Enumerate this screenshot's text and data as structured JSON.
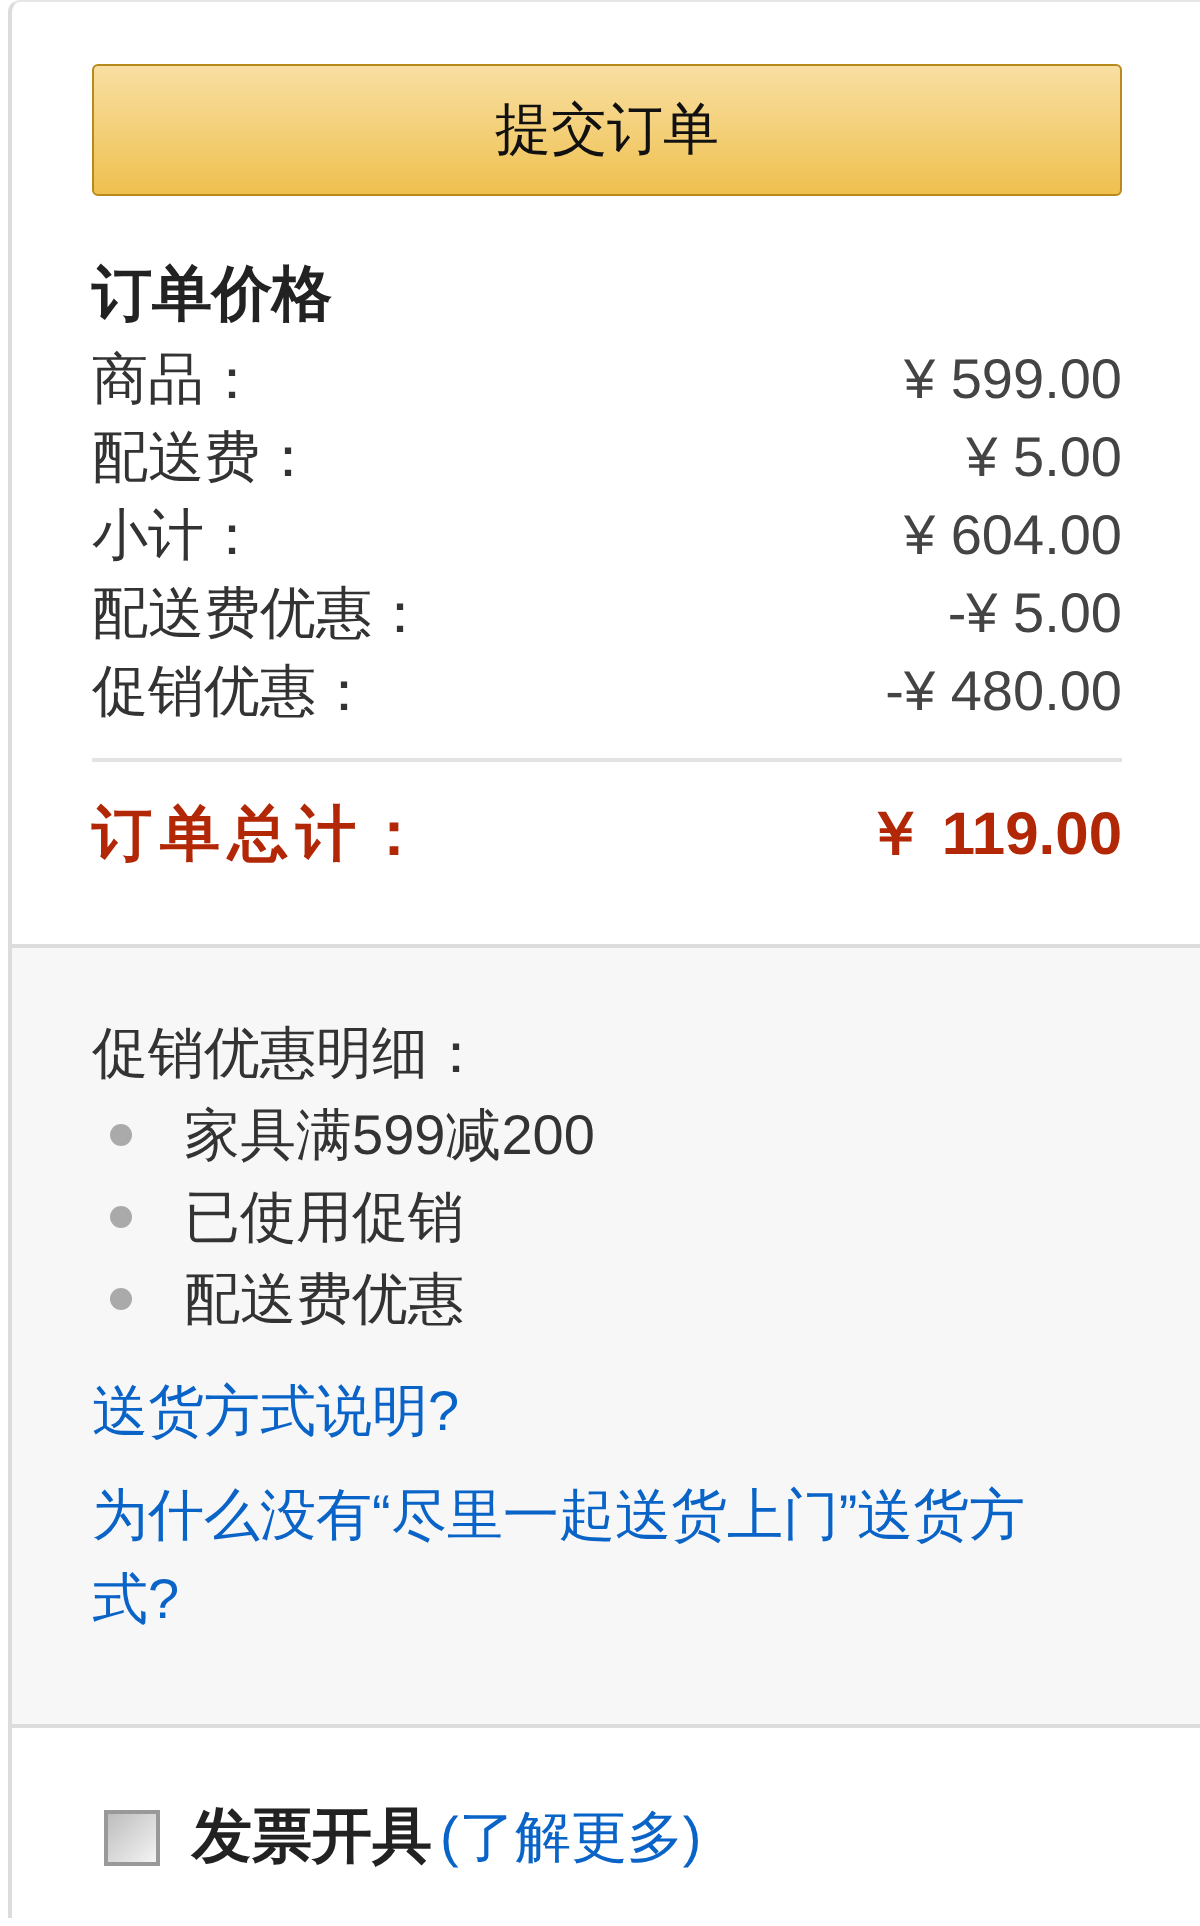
{
  "submit_button": {
    "label": "提交订单"
  },
  "order_price": {
    "title": "订单价格",
    "lines": [
      {
        "label": "商品：",
        "amount": "¥ 599.00"
      },
      {
        "label": "配送费：",
        "amount": "¥ 5.00"
      },
      {
        "label": "小计：",
        "amount": "¥ 604.00"
      },
      {
        "label": "配送费优惠：",
        "amount": "-¥ 5.00"
      },
      {
        "label": "促销优惠：",
        "amount": "-¥ 480.00"
      }
    ],
    "total": {
      "label": "订单总计：",
      "amount": "￥ 119.00"
    }
  },
  "promotion_details": {
    "title": "促销优惠明细：",
    "items": [
      "家具满599减200",
      "已使用促销",
      "配送费优惠"
    ]
  },
  "links": [
    "送货方式说明?",
    "为什么没有“尽里一起送货上门”送货方式?"
  ],
  "invoice": {
    "checked": false,
    "label": "发票开具",
    "link": "(了解更多)"
  }
}
